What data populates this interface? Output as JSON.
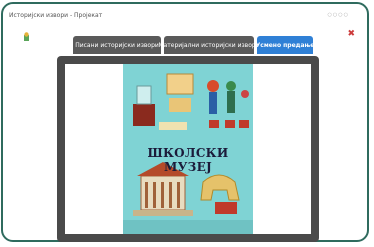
{
  "window": {
    "title": "Историјски извори - Пројекат",
    "controls_text": "○○○○",
    "close_glyph": "✖"
  },
  "tabs": [
    {
      "label": "Писани историјски извори",
      "active": false
    },
    {
      "label": "Материјални историјски извори",
      "active": false
    },
    {
      "label": "Усмено предање",
      "active": true
    }
  ],
  "viewer": {
    "poster_title": "ШКОЛСКИ МУЗЕЈ"
  },
  "colors": {
    "frame_border": "#2f6b5e",
    "tab_bg": "#5a5a5a",
    "tab_active_bg": "#2f80d6",
    "viewer_bg": "#4a4a4a",
    "poster_bg": "#7fd3d4"
  }
}
